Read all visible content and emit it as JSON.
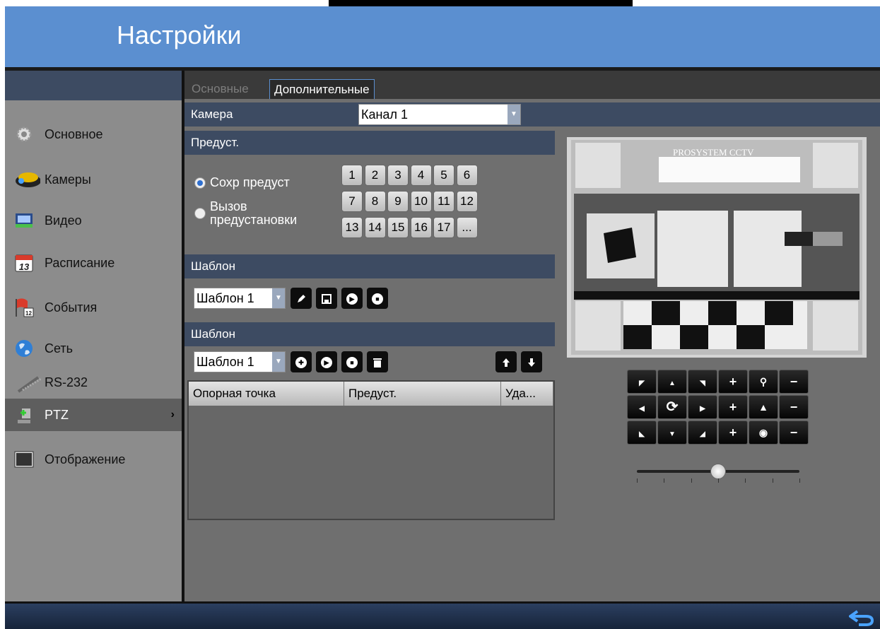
{
  "header": {
    "title": "Настройки"
  },
  "sidebar": {
    "items": [
      {
        "label": "Основное",
        "icon": "gear-icon"
      },
      {
        "label": "Камеры",
        "icon": "camera-icon"
      },
      {
        "label": "Видео",
        "icon": "video-icon"
      },
      {
        "label": "Расписание",
        "icon": "calendar-icon",
        "icon_text": "13"
      },
      {
        "label": "События",
        "icon": "event-flag-icon",
        "icon_text": "12"
      },
      {
        "label": "Сеть",
        "icon": "globe-icon"
      },
      {
        "label": "RS-232",
        "icon": "cable-icon"
      },
      {
        "label": "PTZ",
        "icon": "ptz-icon",
        "active": true,
        "chevron": "›"
      },
      {
        "label": "Отображение",
        "icon": "monitor-icon"
      }
    ]
  },
  "tabs": [
    {
      "label": "Основные",
      "active": false
    },
    {
      "label": "Дополнительные",
      "active": true
    }
  ],
  "camera": {
    "label": "Камера",
    "value": "Канал 1"
  },
  "preset": {
    "section": "Предуст.",
    "save_label": "Сохр предуст",
    "call_label": "Вызов\nпредустановки",
    "call_line1": "Вызов",
    "call_line2": "предустановки",
    "numbers": [
      "1",
      "2",
      "3",
      "4",
      "5",
      "6",
      "7",
      "8",
      "9",
      "10",
      "11",
      "12",
      "13",
      "14",
      "15",
      "16",
      "17",
      "..."
    ]
  },
  "pattern": {
    "section": "Шаблон",
    "value": "Шаблон 1"
  },
  "patrol": {
    "section": "Шаблон",
    "value": "Шаблон 1"
  },
  "table": {
    "columns": [
      "Опорная точка",
      "Предуст.",
      "Уда..."
    ]
  },
  "preview": {
    "overlay_text": "PROSYSTEM CCTV"
  },
  "ptz": {
    "slider_value": 0.5
  },
  "colors": {
    "header": "#5b8fd0",
    "section_bar": "#3d4b62",
    "panel": "#6f6f6f",
    "sidebar": "#8c8c8c"
  }
}
